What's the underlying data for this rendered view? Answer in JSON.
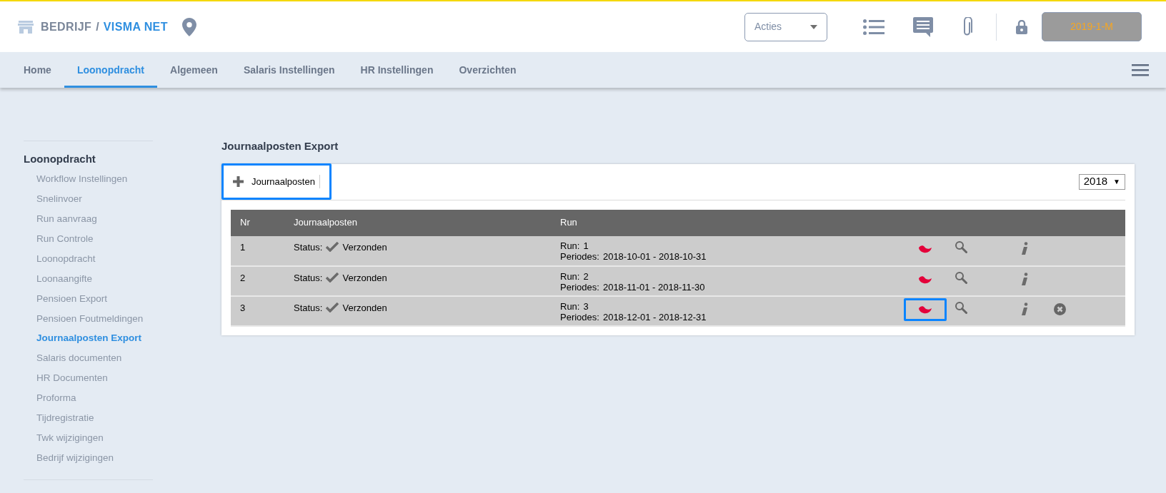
{
  "header": {
    "company": "BEDRIJF",
    "separator": "/",
    "environment": "VISMA NET",
    "actions_label": "Acties",
    "period_button": "2019-1-M"
  },
  "tabs": [
    {
      "label": "Home",
      "selected": false
    },
    {
      "label": "Loonopdracht",
      "selected": true
    },
    {
      "label": "Algemeen",
      "selected": false
    },
    {
      "label": "Salaris Instellingen",
      "selected": false
    },
    {
      "label": "HR Instellingen",
      "selected": false
    },
    {
      "label": "Overzichten",
      "selected": false
    }
  ],
  "sidebar": {
    "title": "Loonopdracht",
    "items": [
      {
        "label": "Workflow Instellingen",
        "selected": false
      },
      {
        "label": "Snelinvoer",
        "selected": false
      },
      {
        "label": "Run aanvraag",
        "selected": false
      },
      {
        "label": "Run Controle",
        "selected": false
      },
      {
        "label": "Loonopdracht",
        "selected": false
      },
      {
        "label": "Loonaangifte",
        "selected": false
      },
      {
        "label": "Pensioen Export",
        "selected": false
      },
      {
        "label": "Pensioen Foutmeldingen",
        "selected": false
      },
      {
        "label": "Journaalposten Export",
        "selected": true
      },
      {
        "label": "Salaris documenten",
        "selected": false
      },
      {
        "label": "HR Documenten",
        "selected": false
      },
      {
        "label": "Proforma",
        "selected": false
      },
      {
        "label": "Tijdregistratie",
        "selected": false
      },
      {
        "label": "Twk wijzigingen",
        "selected": false
      },
      {
        "label": "Bedrijf wijzigingen",
        "selected": false
      }
    ]
  },
  "page_title": "Journaalposten Export",
  "add_button": {
    "label": "Journaalposten",
    "highlighted": true
  },
  "year_select": {
    "value": "2018",
    "arrow": "▼"
  },
  "table": {
    "columns": [
      "Nr",
      "Journaalposten",
      "Run"
    ],
    "rows": [
      {
        "nr": "1",
        "status_label": "Status:",
        "status": "Verzonden",
        "run_label": "Run:",
        "run": "1",
        "period_label": "Periodes:",
        "period": "2018-10-01 - 2018-10-31",
        "export_highlighted": false,
        "deletable": false
      },
      {
        "nr": "2",
        "status_label": "Status:",
        "status": "Verzonden",
        "run_label": "Run:",
        "run": "2",
        "period_label": "Periodes:",
        "period": "2018-11-01 - 2018-11-30",
        "export_highlighted": false,
        "deletable": false
      },
      {
        "nr": "3",
        "status_label": "Status:",
        "status": "Verzonden",
        "run_label": "Run:",
        "run": "3",
        "period_label": "Periodes:",
        "period": "2018-12-01 - 2018-12-31",
        "export_highlighted": true,
        "deletable": true
      }
    ]
  }
}
